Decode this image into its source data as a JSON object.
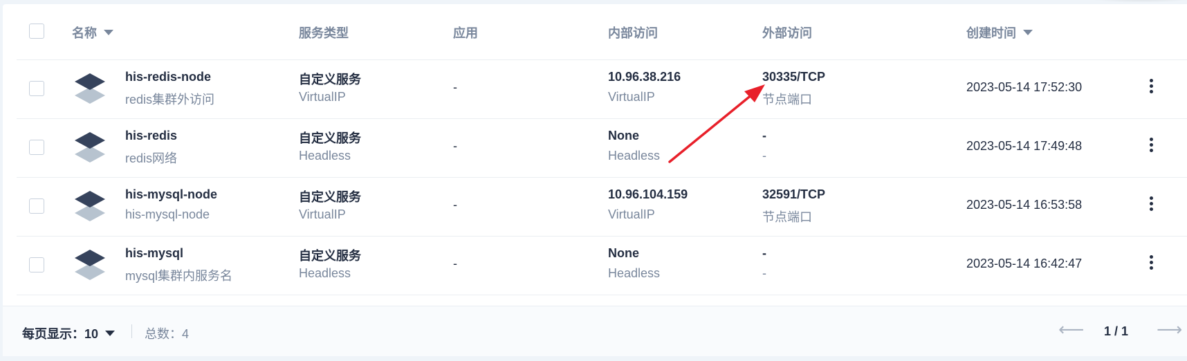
{
  "table": {
    "headers": {
      "name": "名称",
      "service_type": "服务类型",
      "app": "应用",
      "internal_access": "内部访问",
      "external_access": "外部访问",
      "created_time": "创建时间"
    },
    "rows": [
      {
        "name": "his-redis-node",
        "desc": "redis集群外访问",
        "type": "自定义服务",
        "type_sub": "VirtualIP",
        "app": "-",
        "internal": "10.96.38.216",
        "internal_sub": "VirtualIP",
        "external": "30335/TCP",
        "external_sub": "节点端口",
        "created": "2023-05-14 17:52:30"
      },
      {
        "name": "his-redis",
        "desc": "redis网络",
        "type": "自定义服务",
        "type_sub": "Headless",
        "app": "-",
        "internal": "None",
        "internal_sub": "Headless",
        "external": "-",
        "external_sub": "-",
        "created": "2023-05-14 17:49:48"
      },
      {
        "name": "his-mysql-node",
        "desc": "his-mysql-node",
        "type": "自定义服务",
        "type_sub": "VirtualIP",
        "app": "-",
        "internal": "10.96.104.159",
        "internal_sub": "VirtualIP",
        "external": "32591/TCP",
        "external_sub": "节点端口",
        "created": "2023-05-14 16:53:58"
      },
      {
        "name": "his-mysql",
        "desc": "mysql集群内服务名",
        "type": "自定义服务",
        "type_sub": "Headless",
        "app": "-",
        "internal": "None",
        "internal_sub": "Headless",
        "external": "-",
        "external_sub": "-",
        "created": "2023-05-14 16:42:47"
      }
    ]
  },
  "footer": {
    "per_page_label": "每页显示：",
    "per_page_value": "10",
    "total_label": "总数：",
    "total_value": "4",
    "page_indicator": "1 / 1",
    "prev_icon": "arrow-left-icon",
    "next_icon": "arrow-right-icon"
  },
  "annotation": {
    "color": "#e8202a",
    "icon": "red-arrow-annotation"
  }
}
